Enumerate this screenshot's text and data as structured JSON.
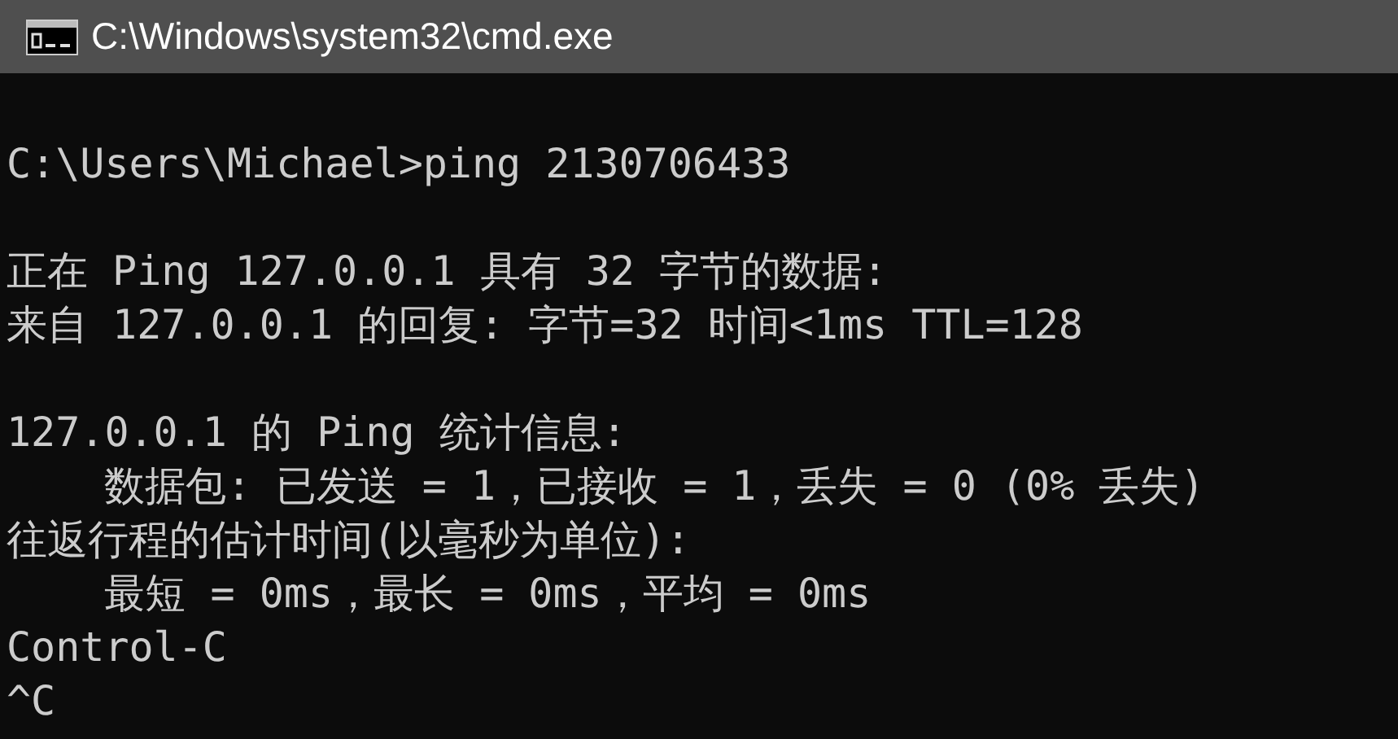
{
  "window": {
    "title": "C:\\Windows\\system32\\cmd.exe"
  },
  "console": {
    "lines": [
      {
        "kind": "blank"
      },
      {
        "kind": "text",
        "text": "C:\\Users\\Michael>ping 2130706433"
      },
      {
        "kind": "blank"
      },
      {
        "kind": "text",
        "text": "正在 Ping 127.0.0.1 具有 32 字节的数据:"
      },
      {
        "kind": "text",
        "text": "来自 127.0.0.1 的回复: 字节=32 时间<1ms TTL=128"
      },
      {
        "kind": "blank"
      },
      {
        "kind": "text",
        "text": "127.0.0.1 的 Ping 统计信息:"
      },
      {
        "kind": "text",
        "text": "    数据包: 已发送 = 1，已接收 = 1，丢失 = 0 (0% 丢失)"
      },
      {
        "kind": "text",
        "text": "往返行程的估计时间(以毫秒为单位):"
      },
      {
        "kind": "text",
        "text": "    最短 = 0ms，最长 = 0ms，平均 = 0ms"
      },
      {
        "kind": "text",
        "text": "Control-C"
      },
      {
        "kind": "text",
        "text": "^C"
      }
    ]
  }
}
